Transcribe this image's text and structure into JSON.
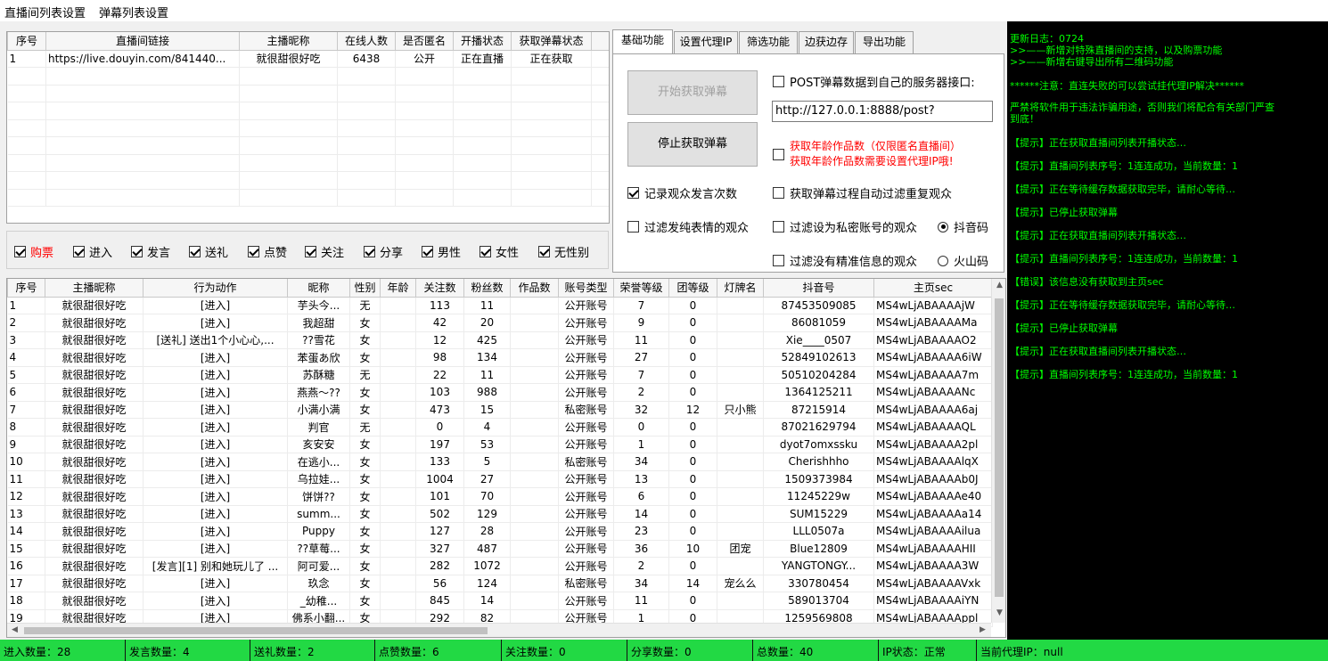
{
  "menu": {
    "live_list_settings": "直播间列表设置",
    "danmaku_list_settings": "弹幕列表设置"
  },
  "rooms_table": {
    "headers": [
      "序号",
      "直播间链接",
      "主播昵称",
      "在线人数",
      "是否匿名",
      "开播状态",
      "获取弹幕状态"
    ],
    "rows": [
      [
        "1",
        "https://live.douyin.com/841440...",
        "就很甜很好吃",
        "6438",
        "公开",
        "正在直播",
        "正在获取"
      ]
    ]
  },
  "filters": [
    {
      "label": "购票",
      "checked": true,
      "color": "#ff0000"
    },
    {
      "label": "进入",
      "checked": true
    },
    {
      "label": "发言",
      "checked": true
    },
    {
      "label": "送礼",
      "checked": true
    },
    {
      "label": "点赞",
      "checked": true
    },
    {
      "label": "关注",
      "checked": true
    },
    {
      "label": "分享",
      "checked": true
    },
    {
      "label": "男性",
      "checked": true
    },
    {
      "label": "女性",
      "checked": true
    },
    {
      "label": "无性别",
      "checked": true
    }
  ],
  "tabs": [
    "基础功能",
    "设置代理IP",
    "筛选功能",
    "边获边存",
    "导出功能"
  ],
  "basic": {
    "start_button": "开始获取弹幕",
    "stop_button": "停止获取弹幕",
    "post_label": "POST弹幕数据到自己的服务器接口:",
    "post_url": "http://127.0.0.1:8888/post?",
    "age_label_1": "获取年龄作品数（仅限匿名直播间）",
    "age_label_2": "获取年龄作品数需要设置代理IP哦!",
    "record_count": "记录观众发言次数",
    "auto_filter_dup": "获取弹幕过程自动过滤重复观众",
    "filter_emoji": "过滤发纯表情的观众",
    "filter_private": "过滤设为私密账号的观众",
    "filter_no_info": "过滤没有精准信息的观众",
    "radio_douyin": "抖音码",
    "radio_huoshan": "火山码"
  },
  "log": [
    "更新日志：0724",
    ">>——新增对特殊直播间的支持，以及购票功能",
    ">>——新增右键导出所有二维码功能",
    "******注意：直连失败的可以尝试挂代理IP解决******",
    "严禁将软件用于违法诈骗用途，否则我们将配合有关部门严查",
    "到底！",
    "【提示】正在获取直播间列表开播状态…",
    "【提示】直播间列表序号：1连连成功，当前数量：1",
    "【提示】正在等待缓存数据获取完毕，请耐心等待…",
    "【提示】已停止获取弹幕",
    "【提示】正在获取直播间列表开播状态…",
    "【提示】直播间列表序号：1连连成功，当前数量：1",
    "【错误】该信息没有获取到主页sec",
    "【提示】正在等待缓存数据获取完毕，请耐心等待…",
    "【提示】已停止获取弹幕",
    "【提示】正在获取直播间列表开播状态…",
    "【提示】直播间列表序号：1连连成功，当前数量：1"
  ],
  "viewers_table": {
    "headers": [
      "序号",
      "主播昵称",
      "行为动作",
      "昵称",
      "性别",
      "年龄",
      "关注数",
      "粉丝数",
      "作品数",
      "账号类型",
      "荣誉等级",
      "团等级",
      "灯牌名",
      "抖音号",
      "主页sec"
    ],
    "rows": [
      [
        "1",
        "就很甜很好吃",
        "[进入]",
        "芋头今...",
        "无",
        "",
        "113",
        "11",
        "",
        "公开账号",
        "7",
        "0",
        "",
        "87453509085",
        "MS4wLjABAAAAjW"
      ],
      [
        "2",
        "就很甜很好吃",
        "[进入]",
        "我超甜",
        "女",
        "",
        "42",
        "20",
        "",
        "公开账号",
        "9",
        "0",
        "",
        "86081059",
        "MS4wLjABAAAAMa"
      ],
      [
        "3",
        "就很甜很好吃",
        "[送礼] 送出1个小心心,...",
        "??雪花",
        "女",
        "",
        "12",
        "425",
        "",
        "公开账号",
        "11",
        "0",
        "",
        "Xie____0507",
        "MS4wLjABAAAAO2"
      ],
      [
        "4",
        "就很甜很好吃",
        "[进入]",
        "苯蛋あ欣",
        "女",
        "",
        "98",
        "134",
        "",
        "公开账号",
        "27",
        "0",
        "",
        "52849102613",
        "MS4wLjABAAAA6iW"
      ],
      [
        "5",
        "就很甜很好吃",
        "[进入]",
        "苏酥糖",
        "无",
        "",
        "22",
        "11",
        "",
        "公开账号",
        "7",
        "0",
        "",
        "50510204284",
        "MS4wLjABAAAA7m"
      ],
      [
        "6",
        "就很甜很好吃",
        "[进入]",
        "燕燕～??",
        "女",
        "",
        "103",
        "988",
        "",
        "公开账号",
        "2",
        "0",
        "",
        "1364125211",
        "MS4wLjABAAAANc"
      ],
      [
        "7",
        "就很甜很好吃",
        "[进入]",
        "小满小满",
        "女",
        "",
        "473",
        "15",
        "",
        "私密账号",
        "32",
        "12",
        "只小熊",
        "87215914",
        "MS4wLjABAAAA6aj"
      ],
      [
        "8",
        "就很甜很好吃",
        "[进入]",
        "判官",
        "无",
        "",
        "0",
        "4",
        "",
        "公开账号",
        "0",
        "0",
        "",
        "87021629794",
        "MS4wLjABAAAAQL"
      ],
      [
        "9",
        "就很甜很好吃",
        "[进入]",
        "亥安安",
        "女",
        "",
        "197",
        "53",
        "",
        "公开账号",
        "1",
        "0",
        "",
        "dyot7omxssku",
        "MS4wLjABAAAA2pl"
      ],
      [
        "10",
        "就很甜很好吃",
        "[进入]",
        "在逃小...",
        "女",
        "",
        "133",
        "5",
        "",
        "私密账号",
        "34",
        "0",
        "",
        "Cherishhho",
        "MS4wLjABAAAAlqX"
      ],
      [
        "11",
        "就很甜很好吃",
        "[进入]",
        "乌拉娃...",
        "女",
        "",
        "1004",
        "27",
        "",
        "公开账号",
        "13",
        "0",
        "",
        "1509373984",
        "MS4wLjABAAAAb0J"
      ],
      [
        "12",
        "就很甜很好吃",
        "[进入]",
        "饼饼??",
        "女",
        "",
        "101",
        "70",
        "",
        "公开账号",
        "6",
        "0",
        "",
        "11245229w",
        "MS4wLjABAAAAe40"
      ],
      [
        "13",
        "就很甜很好吃",
        "[进入]",
        "summ...",
        "女",
        "",
        "502",
        "129",
        "",
        "公开账号",
        "14",
        "0",
        "",
        "SUM15229",
        "MS4wLjABAAAAa14"
      ],
      [
        "14",
        "就很甜很好吃",
        "[进入]",
        "Puppy",
        "女",
        "",
        "127",
        "28",
        "",
        "公开账号",
        "23",
        "0",
        "",
        "LLL0507a",
        "MS4wLjABAAAAilua"
      ],
      [
        "15",
        "就很甜很好吃",
        "[进入]",
        "??草莓...",
        "女",
        "",
        "327",
        "487",
        "",
        "公开账号",
        "36",
        "10",
        "团宠",
        "Blue12809",
        "MS4wLjABAAAAHII"
      ],
      [
        "16",
        "就很甜很好吃",
        "[发言][1] 别和她玩儿了 ...",
        "阿可爱...",
        "女",
        "",
        "282",
        "1072",
        "",
        "公开账号",
        "2",
        "0",
        "",
        "YANGTONGY...",
        "MS4wLjABAAAA3W"
      ],
      [
        "17",
        "就很甜很好吃",
        "[进入]",
        "玖念",
        "女",
        "",
        "56",
        "124",
        "",
        "私密账号",
        "34",
        "14",
        "宠么么",
        "330780454",
        "MS4wLjABAAAAVxk"
      ],
      [
        "18",
        "就很甜很好吃",
        "[进入]",
        "_幼稚...",
        "女",
        "",
        "845",
        "14",
        "",
        "公开账号",
        "11",
        "0",
        "",
        "589013704",
        "MS4wLjABAAAAiYN"
      ],
      [
        "19",
        "就很甜很好吃",
        "[进入]",
        "佛系小翻...",
        "女",
        "",
        "292",
        "82",
        "",
        "公开账号",
        "1",
        "0",
        "",
        "1259569808",
        "MS4wLjABAAAAppl"
      ]
    ]
  },
  "status": [
    "进入数量：28",
    "发言数量：4",
    "送礼数量：2",
    "点赞数量：6",
    "关注数量：0",
    "分享数量：0",
    "总数量：40",
    "IP状态：正常",
    "当前代理IP：null"
  ],
  "colors": {
    "log_text": "#00ff00",
    "log_bg": "#000000",
    "status_bg": "#22d944",
    "warn_red": "#ff0000"
  }
}
